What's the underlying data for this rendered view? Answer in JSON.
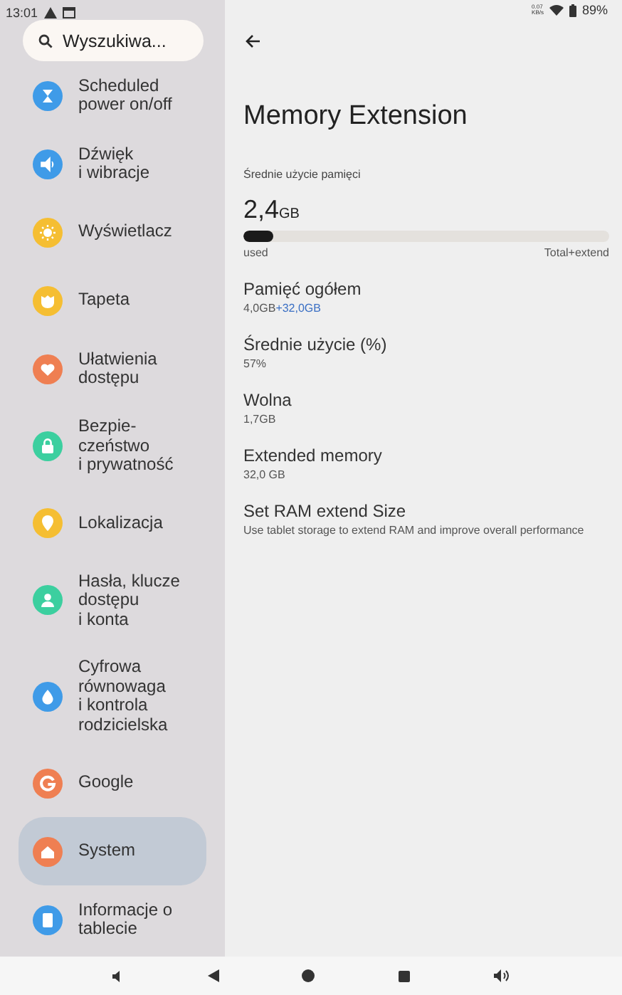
{
  "status_bar": {
    "time": "13:01",
    "net_speed": [
      "0.07",
      "KB/s"
    ],
    "battery": "89%"
  },
  "search": {
    "placeholder": "Wyszukiwa..."
  },
  "sidebar": {
    "items": [
      {
        "label": "Scheduled\npower on/off",
        "kind": "hourglass",
        "color": "#3f9be8",
        "selected": false
      },
      {
        "label": "Dźwięk\ni wibracje",
        "kind": "speaker",
        "color": "#3f9be8",
        "selected": false
      },
      {
        "label": "Wyświetlacz",
        "kind": "sun",
        "color": "#f5be32",
        "selected": false
      },
      {
        "label": "Tapeta",
        "kind": "shirt",
        "color": "#f5be32",
        "selected": false
      },
      {
        "label": "Ułatwienia\ndostępu",
        "kind": "heart",
        "color": "#ef7f52",
        "selected": false
      },
      {
        "label": "Bezpie-\nczeństwo\ni prywatność",
        "kind": "lock",
        "color": "#3ccf9f",
        "selected": false
      },
      {
        "label": "Lokalizacja",
        "kind": "pin",
        "color": "#f5be32",
        "selected": false
      },
      {
        "label": "Hasła, klucze\ndostępu\ni konta",
        "kind": "person",
        "color": "#3ccf9f",
        "selected": false
      },
      {
        "label": "Cyfrowa\nrównowaga\ni kontrola\nrodzicielska",
        "kind": "drop",
        "color": "#3f9be8",
        "selected": false
      },
      {
        "label": "Google",
        "kind": "g",
        "color": "#ef7f52",
        "selected": false
      },
      {
        "label": "System",
        "kind": "house",
        "color": "#ef7f52",
        "selected": true
      },
      {
        "label": "Informacje o\ntablecie",
        "kind": "tablet",
        "color": "#3f9be8",
        "selected": false
      }
    ]
  },
  "page": {
    "title": "Memory Extension",
    "usage": {
      "heading": "Średnie użycie pamięci",
      "value": "2,4",
      "unit": "GB",
      "level": 0.08,
      "left_label": "used",
      "right_label": "Total+extend"
    },
    "rows": [
      {
        "title": "Pamięć ogółem",
        "value": "4,0GB",
        "extra": "+32,0GB"
      },
      {
        "title": "Średnie użycie (%)",
        "value": "57%"
      },
      {
        "title": "Wolna",
        "value": "1,7GB"
      },
      {
        "title": "Extended memory",
        "value": "32,0 GB"
      },
      {
        "title": "Set RAM extend Size",
        "value": "Use tablet storage to extend RAM and improve overall performance"
      }
    ]
  }
}
